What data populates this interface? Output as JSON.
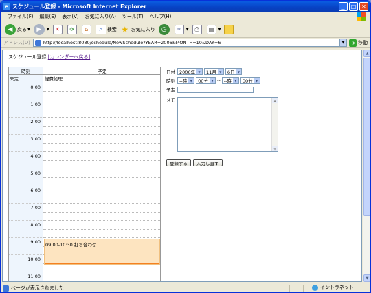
{
  "window": {
    "title": "スケジュール登録 - Microsoft Internet Explorer"
  },
  "menu": [
    "ファイル(F)",
    "編集(E)",
    "表示(V)",
    "お気に入り(A)",
    "ツール(T)",
    "ヘルプ(H)"
  ],
  "toolbar": {
    "back": "戻る",
    "search": "検索",
    "favorites": "お気に入り"
  },
  "address": {
    "label": "アドレス(D)",
    "url": "http://localhost:8080/schedule/NewSchedule?YEAR=2006&MONTH=10&DAY=6",
    "go": "移動"
  },
  "page": {
    "heading": "スケジュール登録",
    "calendar_link": "[カレンダーへ戻る]",
    "table": {
      "col_time": "時刻",
      "col_plan": "予定",
      "allday_label": "未定",
      "allday_value": "経費処理",
      "hours": [
        "0:00",
        "1:00",
        "2:00",
        "3:00",
        "4:00",
        "5:00",
        "6:00",
        "7:00",
        "8:00",
        "9:00",
        "10:00",
        "11:00"
      ],
      "event": "09:00-10:30 打ち合わせ"
    },
    "form": {
      "date_label": "日付",
      "year": "2006年",
      "month": "11月",
      "day": "6日",
      "time_label": "時刻",
      "start_hour": "--時",
      "start_min": "00分",
      "sep": "--",
      "end_hour": "--時",
      "end_min": "00分",
      "plan_label": "予定",
      "memo_label": "メモ",
      "register_button": "登録する",
      "reset_button": "入力し直す"
    }
  },
  "status": {
    "text": "ページが表示されました",
    "zone": "イントラネット"
  }
}
